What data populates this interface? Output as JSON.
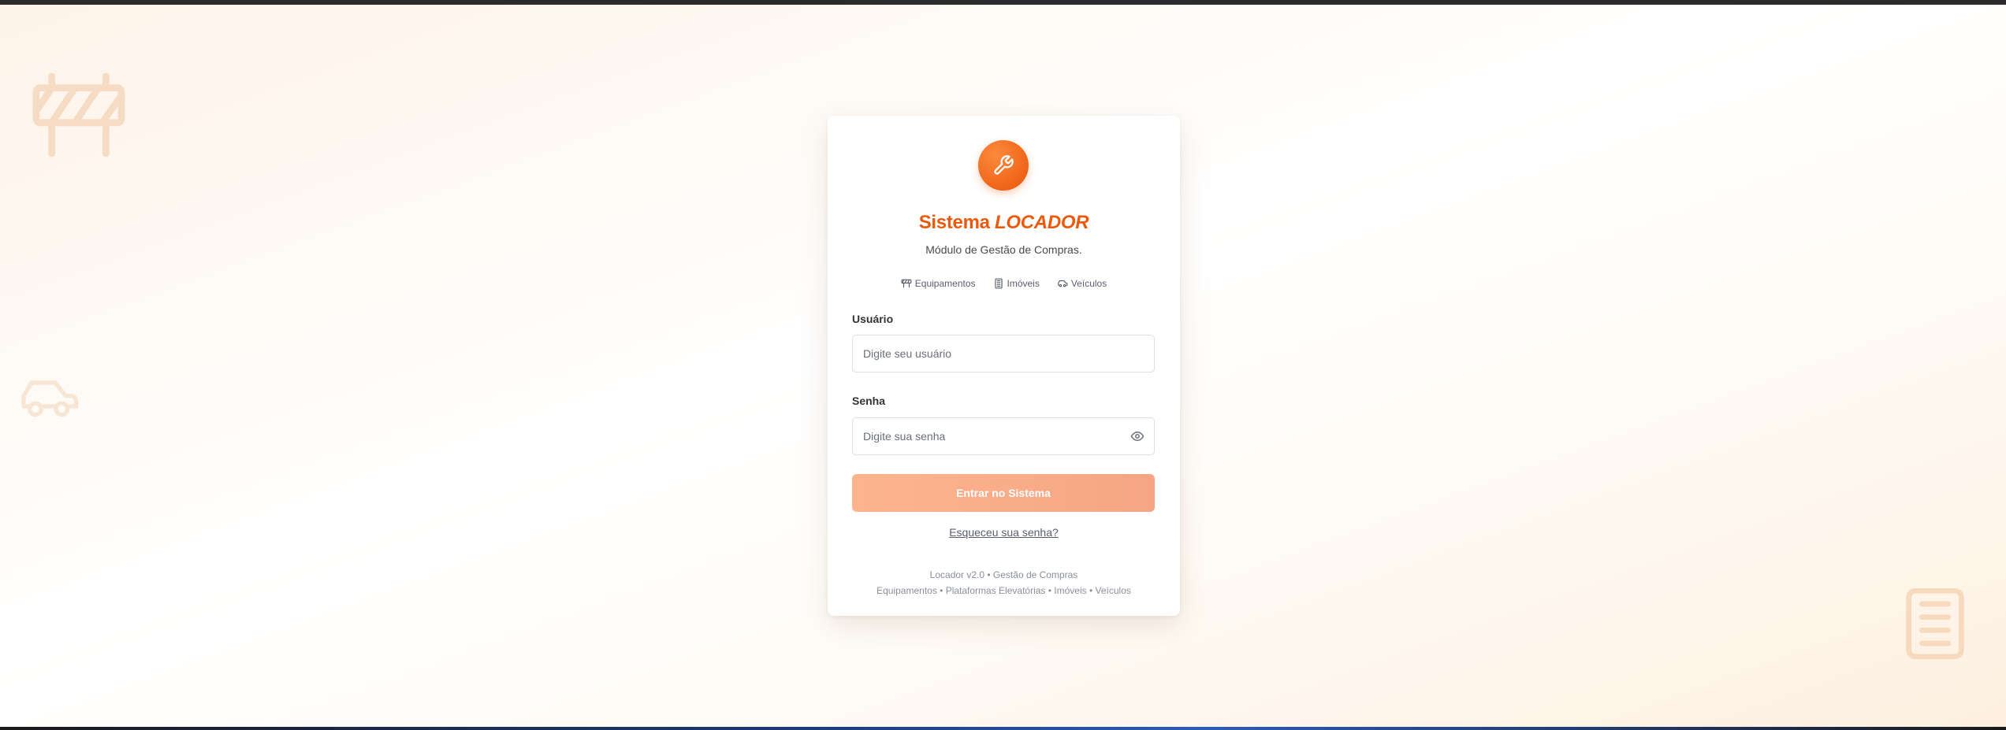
{
  "app": {
    "title_prefix": "Sistema",
    "title_brand": "LOCADOR",
    "subtitle": "Módulo de Gestão de Compras.",
    "logo_icon": "wrench-icon",
    "accent_color": "#ea5a0c"
  },
  "categories": [
    {
      "label": "Equipamentos",
      "icon": "equipment-icon"
    },
    {
      "label": "Imóveis",
      "icon": "building-icon"
    },
    {
      "label": "Veículos",
      "icon": "car-icon"
    }
  ],
  "form": {
    "username_label": "Usuário",
    "username_placeholder": "Digite seu usuário",
    "username_value": "",
    "password_label": "Senha",
    "password_placeholder": "Digite sua senha",
    "password_value": "",
    "submit_label": "Entrar no Sistema",
    "forgot_label": "Esqueceu sua senha?"
  },
  "footer": {
    "version_line": "Locador v2.0 • Gestão de Compras",
    "modules_line": "Equipamentos • Plataformas Elevatórias • Imóveis • Veículos"
  }
}
